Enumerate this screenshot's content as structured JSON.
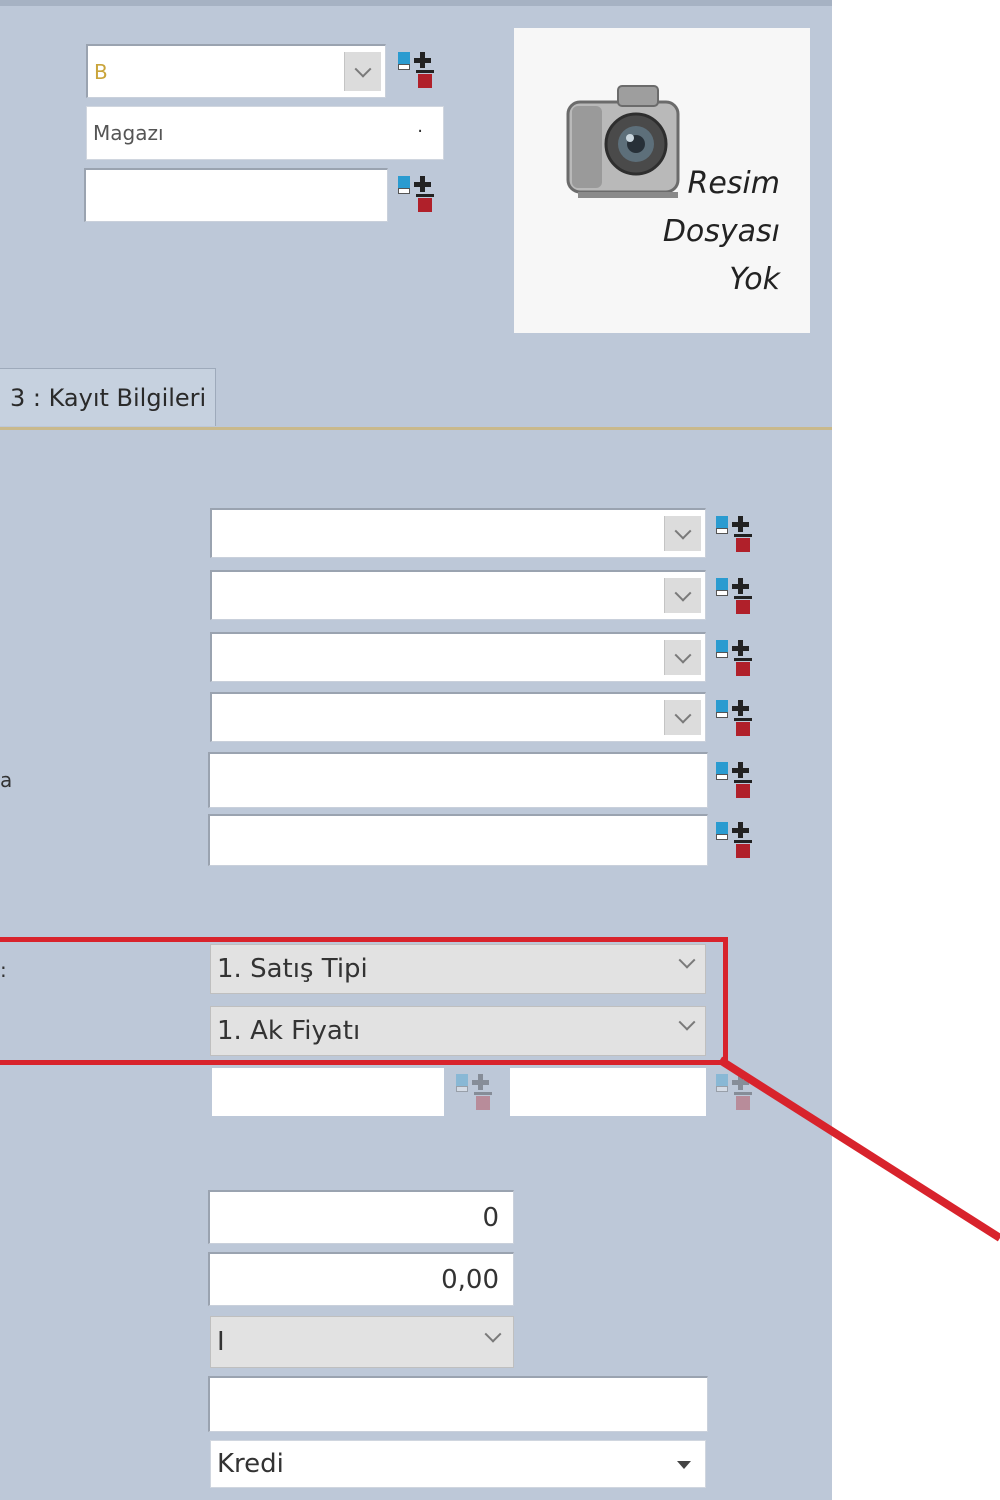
{
  "header": {
    "field1_value": "B",
    "field2_value": "Magazı",
    "field3_value": ""
  },
  "photo": {
    "caption_line1": "Resim",
    "caption_line2": "Dosyası",
    "caption_line3": "Yok"
  },
  "tabs": [
    {
      "label": "3 : Kayıt Bilgileri"
    }
  ],
  "form": {
    "dropdown1_value": "",
    "dropdown2_value": "",
    "dropdown3_value": "",
    "dropdown4_value": "",
    "text1_value": "",
    "text2_value": "",
    "side_label_a": "a",
    "side_label_b": ":",
    "type_select_value": "1. Satış Tipi",
    "price_select_value": "1. Ak Fiyatı",
    "range_from_value": "",
    "range_to_value": "",
    "quantity_value": "0",
    "amount_value": "0,00",
    "small_select_value": "I",
    "note_value": "",
    "payment_select_value": "Kredi"
  },
  "colors": {
    "panel_bg": "#bdc8d8",
    "highlight": "#d8232c"
  }
}
